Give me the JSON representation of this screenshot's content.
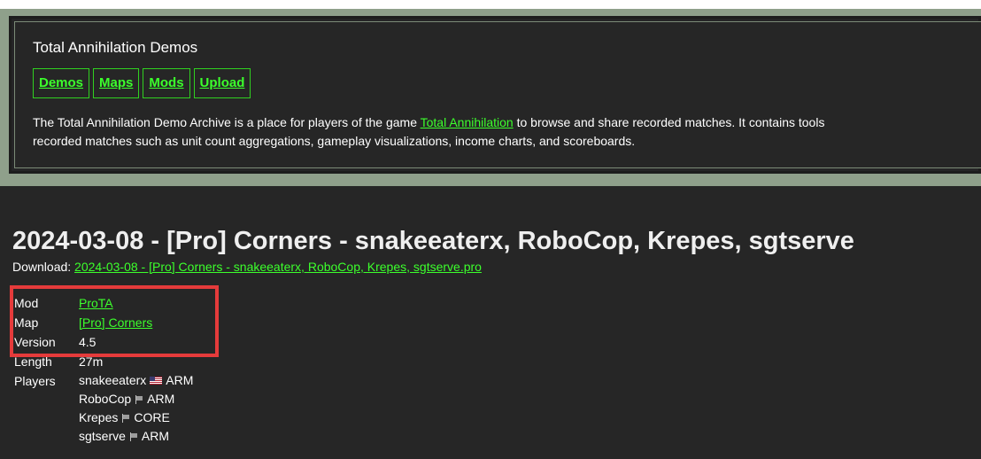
{
  "header": {
    "site_title": "Total Annihilation Demos",
    "nav": [
      {
        "label": "Demos"
      },
      {
        "label": "Maps"
      },
      {
        "label": "Mods"
      },
      {
        "label": "Upload"
      }
    ],
    "intro": {
      "prefix": "The Total Annihilation Demo Archive is a place for players of the game ",
      "link": "Total Annihilation",
      "suffix": " to browse and share recorded matches. It contains tools",
      "line2": "recorded matches such as unit count aggregations, gameplay visualizations, income charts, and scoreboards."
    }
  },
  "demo": {
    "title": "2024-03-08 - [Pro] Corners - snakeeaterx, RoboCop, Krepes, sgtserve",
    "download_label": "Download:",
    "download_file": "2024-03-08 - [Pro] Corners - snakeeaterx, RoboCop, Krepes, sgtserve.pro",
    "meta": {
      "mod_label": "Mod",
      "mod_value": "ProTA",
      "map_label": "Map",
      "map_value": "[Pro] Corners",
      "version_label": "Version",
      "version_value": "4.5",
      "length_label": "Length",
      "length_value": "27m",
      "players_label": "Players"
    },
    "players": [
      {
        "name": "snakeeaterx",
        "flag": "us-flag",
        "side": "ARM"
      },
      {
        "name": "RoboCop",
        "flag": "generic-flag",
        "side": "ARM"
      },
      {
        "name": "Krepes",
        "flag": "generic-flag",
        "side": "CORE"
      },
      {
        "name": "sgtserve",
        "flag": "generic-flag",
        "side": "ARM"
      }
    ]
  },
  "colors": {
    "background": "#262626",
    "link": "#3cff2c",
    "frame": "#8fa08b",
    "highlight": "#e53b3b"
  }
}
